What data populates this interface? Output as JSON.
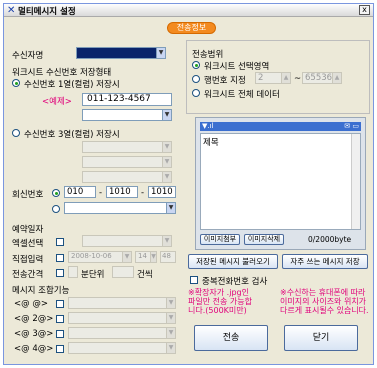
{
  "window": {
    "title": "멀티메시지 설정",
    "close": "x"
  },
  "tab": {
    "label": "전송정보"
  },
  "left": {
    "recipient_label": "수신자명",
    "recipient_value": "",
    "worksheet_section": "워크시트 수신번호 저장형태",
    "col1_label": "수신번호 1열(컬럼) 저장시",
    "example_label": "<예제>",
    "example_value": "011-123-4567",
    "col3_label": "수신번호 3열(컬럼) 저장시",
    "reply_label": "회신번호",
    "reply_parts": [
      "010",
      "1010",
      "1010"
    ],
    "reservation_section": "예약일자",
    "reserve_select_label": "엑셀선택",
    "direct_label": "직접입력",
    "direct_date": "2008-10-06",
    "direct_hour": "14",
    "direct_min": "48",
    "interval_label": "전송간격",
    "interval_unit": "분단위",
    "interval_count_label": "건씩",
    "combine_section": "메시지 조합기능",
    "combine_items": [
      "<@ @>",
      "<@ 2@>",
      "<@ 3@>",
      "<@ 4@>"
    ]
  },
  "right": {
    "range_section": "전송범위",
    "range_opts": [
      "워크시트 선택영역",
      "행번호 지정",
      "워크시트 전체 데이터"
    ],
    "row_from": "2",
    "row_to": "65536",
    "phone_subject_label": "제목",
    "image_attach": "이미지첨부",
    "image_delete": "이미지삭제",
    "byte_count": "0/2000byte",
    "load_saved": "저장된 메시지 불러오기",
    "save_frequent": "자주 쓰는 메시지 저장",
    "dup_check_label": "중복전화번호 검사",
    "note1": "※확장자가 .jpg인\n파일만 전송 가능합\n니다.(500K미만)",
    "note2": "※수신하는 휴대폰에 따라\n이미지의 사이즈와 위치가\n다르게 표시될수 있습니다.",
    "send_button": "전송",
    "close_button": "닫기"
  }
}
